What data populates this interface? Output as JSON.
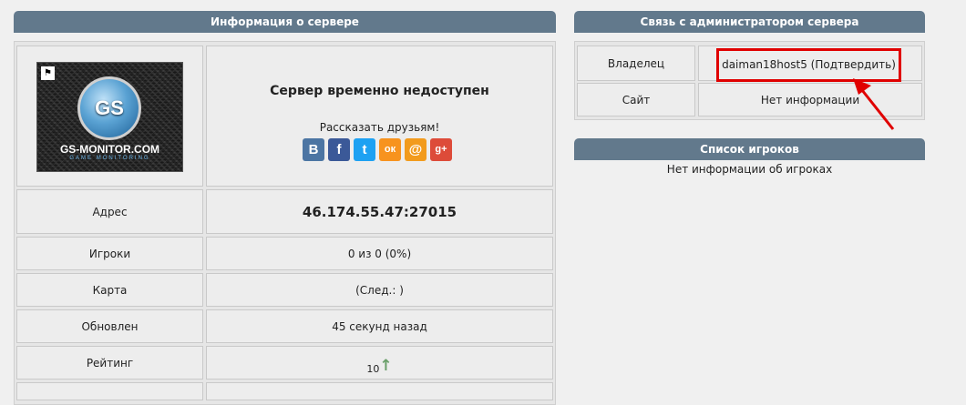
{
  "server_info": {
    "title": "Информация о сервере",
    "status": "Сервер временно недоступен",
    "share_label": "Рассказать друзьям!",
    "logo": {
      "text": "GS-MONITOR.COM",
      "sub": "GAME MONITORING",
      "badge": "GS"
    },
    "social": [
      {
        "name": "vk-icon",
        "glyph": "В",
        "color": "#4c75a3"
      },
      {
        "name": "facebook-icon",
        "glyph": "f",
        "color": "#3b5998"
      },
      {
        "name": "twitter-icon",
        "glyph": "t",
        "color": "#1da1f2"
      },
      {
        "name": "odnoklassniki-icon",
        "glyph": "ок",
        "color": "#f7931e"
      },
      {
        "name": "mailru-icon",
        "glyph": "@",
        "color": "#f29b1d"
      },
      {
        "name": "googleplus-icon",
        "glyph": "g+",
        "color": "#dd4b39"
      }
    ],
    "rows": [
      {
        "label": "Адрес",
        "value": "46.174.55.47:27015"
      },
      {
        "label": "Игроки",
        "value": "0 из 0 (0%)"
      },
      {
        "label": "Карта",
        "value": "(След.:  )"
      },
      {
        "label": "Обновлен",
        "value": "45 секунд назад"
      },
      {
        "label": "Рейтинг",
        "value": "10"
      }
    ]
  },
  "admin": {
    "title": "Связь с администратором сервера",
    "owner_label": "Владелец",
    "owner_value": "daiman18host5 (Подтвердить)",
    "site_label": "Сайт",
    "site_value": "Нет информации"
  },
  "players": {
    "title": "Список игроков",
    "empty_text": "Нет информации об игроках"
  },
  "colors": {
    "header": "#62798c",
    "highlight": "#e00000"
  }
}
